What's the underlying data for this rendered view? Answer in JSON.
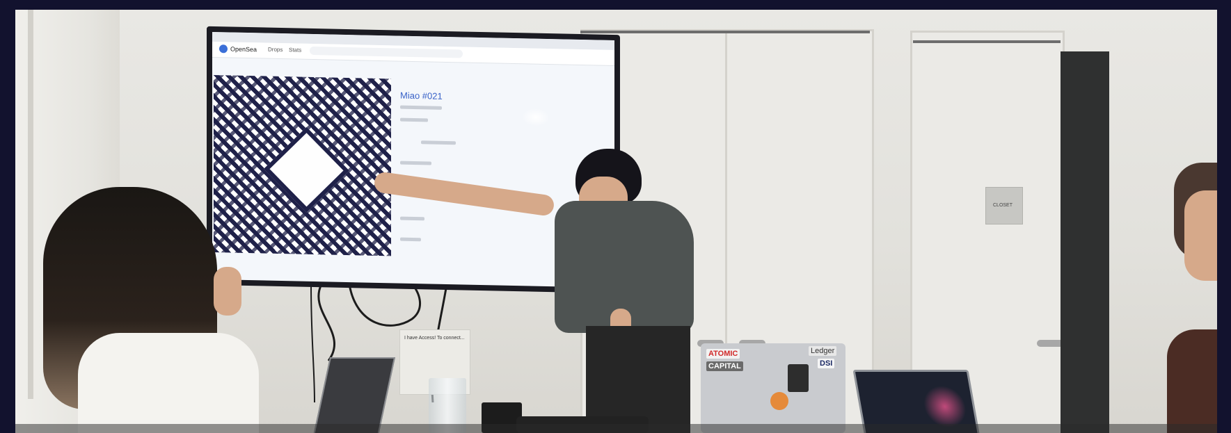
{
  "scene": {
    "tv_screen": {
      "app_name": "OpenSea",
      "nav_items": [
        "Drops",
        "Stats"
      ],
      "item_title": "Miao #021"
    },
    "closet_sign": "CLOSET",
    "desk_sign_title": "I have Access! To connect...",
    "laptop_stickers": [
      "ATOMIC",
      "CAPITAL",
      "Ledger",
      "DSI"
    ]
  }
}
